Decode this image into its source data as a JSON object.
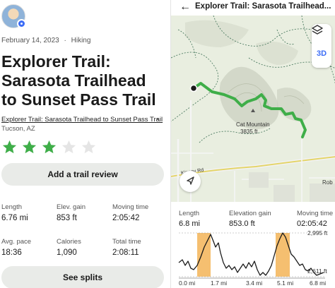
{
  "left": {
    "date": "February 14, 2023",
    "separator": "·",
    "activity": "Hiking",
    "title_lines": [
      "Explorer Trail:",
      "Sarasota Trailhead",
      "to Sunset Pass Trail"
    ],
    "trail_link": "Explorer Trail: Sarasota Trailhead to Sunset Pass Trail",
    "bullet": "•",
    "location": "Tucson, AZ",
    "rating": 3,
    "rating_max": 5,
    "review_button": "Add a trail review",
    "stats": [
      {
        "label": "Length",
        "value": "6.76 mi"
      },
      {
        "label": "Elev. gain",
        "value": "853 ft"
      },
      {
        "label": "Moving time",
        "value": "2:05:42"
      },
      {
        "label": "Avg. pace",
        "value": "18:36"
      },
      {
        "label": "Calories",
        "value": "1,090"
      },
      {
        "label": "Total time",
        "value": "2:08:11"
      }
    ],
    "splits_button": "See splits"
  },
  "right": {
    "back_icon": "arrow-left-icon",
    "title": "Explorer Trail: Sarasota Trailhead...",
    "three_d": "3D",
    "map_labels": {
      "mountain": "Cat Mountain",
      "elevation": "3835 ft",
      "road": "Kinney Rd",
      "edge": "Rob"
    },
    "stats": [
      {
        "label": "Length",
        "value": "6.8 mi"
      },
      {
        "label": "Elevation gain",
        "value": "853.0 ft"
      },
      {
        "label": "Moving time",
        "value": "02:05:42"
      }
    ],
    "profile": {
      "max_label": "2,995 ft",
      "min_label": "2,611 ft",
      "x_labels": [
        "0.0 mi",
        "1.7 mi",
        "3.4 mi",
        "5.1 mi",
        "6.8 mi"
      ]
    }
  },
  "colors": {
    "accent_green": "#3fae49",
    "star_empty": "#e5e5e5",
    "highlight": "#f4b860",
    "button_bg": "#e9ebe8"
  }
}
